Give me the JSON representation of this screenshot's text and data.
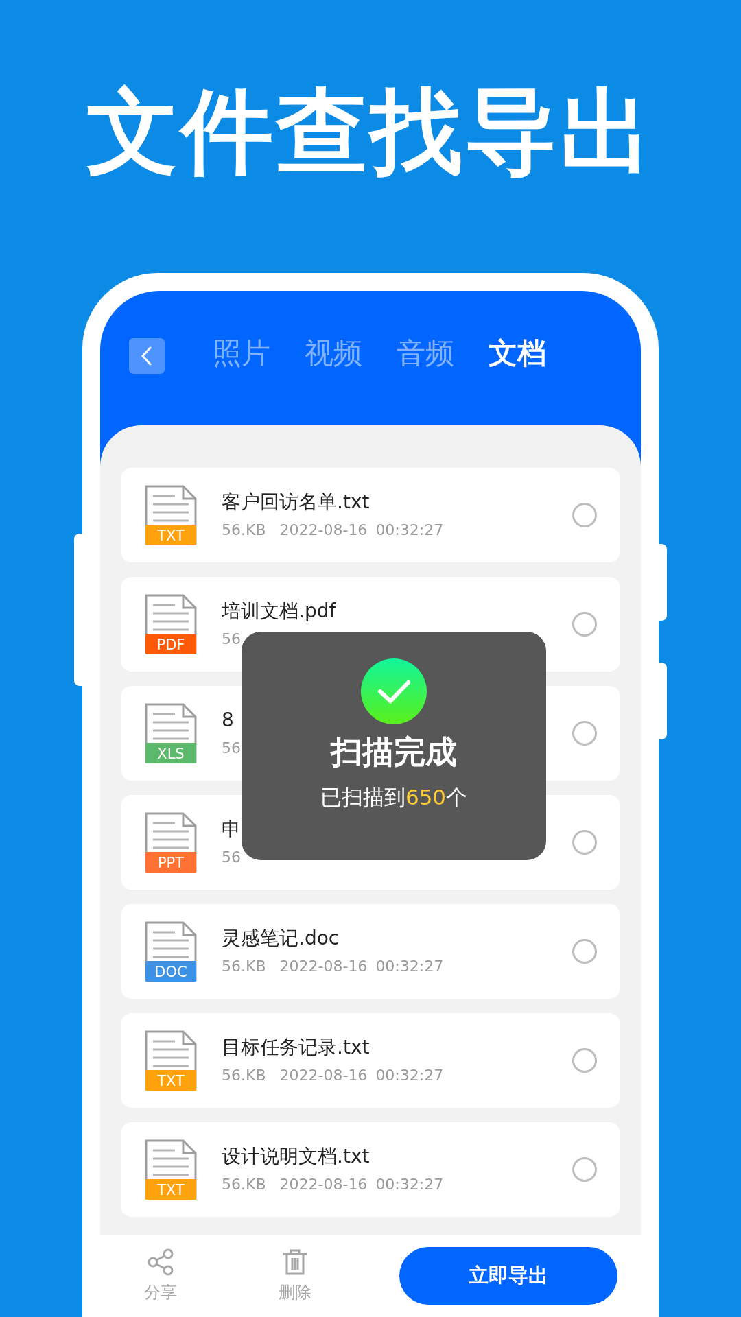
{
  "headline": "文件查找导出",
  "tabs": [
    {
      "label": "照片",
      "selected": false
    },
    {
      "label": "视频",
      "selected": false
    },
    {
      "label": "音频",
      "selected": false
    },
    {
      "label": "文档",
      "selected": true
    }
  ],
  "files": [
    {
      "name": "客户回访名单.txt",
      "tag": "TXT",
      "color": "#ffa20d",
      "size": "56.KB",
      "date": "2022-08-16",
      "time": "00:32:27",
      "selected": false
    },
    {
      "name": "培训文档.pdf",
      "tag": "PDF",
      "color": "#ff5a0a",
      "size": "56",
      "selected": false
    },
    {
      "name": "8",
      "tag": "XLS",
      "color": "#5cb86a",
      "size": "56",
      "selected": false
    },
    {
      "name": "申",
      "tag": "PPT",
      "color": "#ff7033",
      "size": "56",
      "selected": false
    },
    {
      "name": "灵感笔记.doc",
      "tag": "DOC",
      "color": "#3d92e6",
      "size": "56.KB",
      "date": "2022-08-16",
      "time": "00:32:27",
      "selected": false
    },
    {
      "name": "目标任务记录.txt",
      "tag": "TXT",
      "color": "#ffa20d",
      "size": "56.KB",
      "date": "2022-08-16",
      "time": "00:32:27",
      "selected": false
    },
    {
      "name": "设计说明文档.txt",
      "tag": "TXT",
      "color": "#ffa20d",
      "size": "56.KB",
      "date": "2022-08-16",
      "time": "00:32:27",
      "selected": false
    }
  ],
  "toast": {
    "title": "扫描完成",
    "prefix": "已扫描到",
    "count": "650",
    "suffix": "个"
  },
  "bottom_bar": {
    "actions": [
      {
        "kind": "share",
        "label": "分享"
      },
      {
        "kind": "delete",
        "label": "删除"
      }
    ],
    "export_button": "立即导出"
  }
}
